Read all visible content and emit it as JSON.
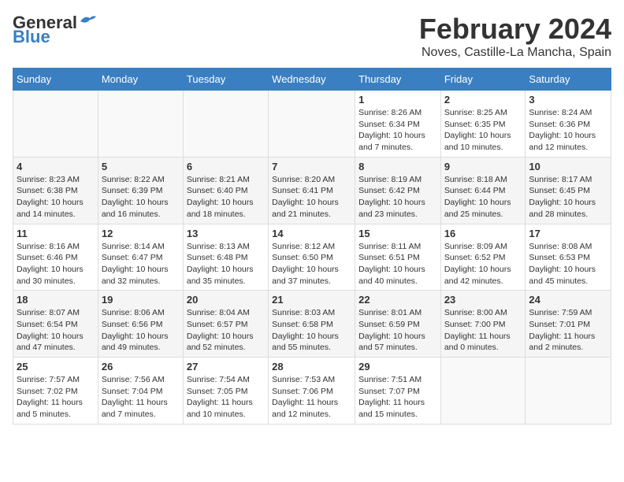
{
  "logo": {
    "general": "General",
    "blue": "Blue"
  },
  "title": "February 2024",
  "location": "Noves, Castille-La Mancha, Spain",
  "days_of_week": [
    "Sunday",
    "Monday",
    "Tuesday",
    "Wednesday",
    "Thursday",
    "Friday",
    "Saturday"
  ],
  "weeks": [
    [
      {
        "day": "",
        "info": ""
      },
      {
        "day": "",
        "info": ""
      },
      {
        "day": "",
        "info": ""
      },
      {
        "day": "",
        "info": ""
      },
      {
        "day": "1",
        "info": "Sunrise: 8:26 AM\nSunset: 6:34 PM\nDaylight: 10 hours\nand 7 minutes."
      },
      {
        "day": "2",
        "info": "Sunrise: 8:25 AM\nSunset: 6:35 PM\nDaylight: 10 hours\nand 10 minutes."
      },
      {
        "day": "3",
        "info": "Sunrise: 8:24 AM\nSunset: 6:36 PM\nDaylight: 10 hours\nand 12 minutes."
      }
    ],
    [
      {
        "day": "4",
        "info": "Sunrise: 8:23 AM\nSunset: 6:38 PM\nDaylight: 10 hours\nand 14 minutes."
      },
      {
        "day": "5",
        "info": "Sunrise: 8:22 AM\nSunset: 6:39 PM\nDaylight: 10 hours\nand 16 minutes."
      },
      {
        "day": "6",
        "info": "Sunrise: 8:21 AM\nSunset: 6:40 PM\nDaylight: 10 hours\nand 18 minutes."
      },
      {
        "day": "7",
        "info": "Sunrise: 8:20 AM\nSunset: 6:41 PM\nDaylight: 10 hours\nand 21 minutes."
      },
      {
        "day": "8",
        "info": "Sunrise: 8:19 AM\nSunset: 6:42 PM\nDaylight: 10 hours\nand 23 minutes."
      },
      {
        "day": "9",
        "info": "Sunrise: 8:18 AM\nSunset: 6:44 PM\nDaylight: 10 hours\nand 25 minutes."
      },
      {
        "day": "10",
        "info": "Sunrise: 8:17 AM\nSunset: 6:45 PM\nDaylight: 10 hours\nand 28 minutes."
      }
    ],
    [
      {
        "day": "11",
        "info": "Sunrise: 8:16 AM\nSunset: 6:46 PM\nDaylight: 10 hours\nand 30 minutes."
      },
      {
        "day": "12",
        "info": "Sunrise: 8:14 AM\nSunset: 6:47 PM\nDaylight: 10 hours\nand 32 minutes."
      },
      {
        "day": "13",
        "info": "Sunrise: 8:13 AM\nSunset: 6:48 PM\nDaylight: 10 hours\nand 35 minutes."
      },
      {
        "day": "14",
        "info": "Sunrise: 8:12 AM\nSunset: 6:50 PM\nDaylight: 10 hours\nand 37 minutes."
      },
      {
        "day": "15",
        "info": "Sunrise: 8:11 AM\nSunset: 6:51 PM\nDaylight: 10 hours\nand 40 minutes."
      },
      {
        "day": "16",
        "info": "Sunrise: 8:09 AM\nSunset: 6:52 PM\nDaylight: 10 hours\nand 42 minutes."
      },
      {
        "day": "17",
        "info": "Sunrise: 8:08 AM\nSunset: 6:53 PM\nDaylight: 10 hours\nand 45 minutes."
      }
    ],
    [
      {
        "day": "18",
        "info": "Sunrise: 8:07 AM\nSunset: 6:54 PM\nDaylight: 10 hours\nand 47 minutes."
      },
      {
        "day": "19",
        "info": "Sunrise: 8:06 AM\nSunset: 6:56 PM\nDaylight: 10 hours\nand 49 minutes."
      },
      {
        "day": "20",
        "info": "Sunrise: 8:04 AM\nSunset: 6:57 PM\nDaylight: 10 hours\nand 52 minutes."
      },
      {
        "day": "21",
        "info": "Sunrise: 8:03 AM\nSunset: 6:58 PM\nDaylight: 10 hours\nand 55 minutes."
      },
      {
        "day": "22",
        "info": "Sunrise: 8:01 AM\nSunset: 6:59 PM\nDaylight: 10 hours\nand 57 minutes."
      },
      {
        "day": "23",
        "info": "Sunrise: 8:00 AM\nSunset: 7:00 PM\nDaylight: 11 hours\nand 0 minutes."
      },
      {
        "day": "24",
        "info": "Sunrise: 7:59 AM\nSunset: 7:01 PM\nDaylight: 11 hours\nand 2 minutes."
      }
    ],
    [
      {
        "day": "25",
        "info": "Sunrise: 7:57 AM\nSunset: 7:02 PM\nDaylight: 11 hours\nand 5 minutes."
      },
      {
        "day": "26",
        "info": "Sunrise: 7:56 AM\nSunset: 7:04 PM\nDaylight: 11 hours\nand 7 minutes."
      },
      {
        "day": "27",
        "info": "Sunrise: 7:54 AM\nSunset: 7:05 PM\nDaylight: 11 hours\nand 10 minutes."
      },
      {
        "day": "28",
        "info": "Sunrise: 7:53 AM\nSunset: 7:06 PM\nDaylight: 11 hours\nand 12 minutes."
      },
      {
        "day": "29",
        "info": "Sunrise: 7:51 AM\nSunset: 7:07 PM\nDaylight: 11 hours\nand 15 minutes."
      },
      {
        "day": "",
        "info": ""
      },
      {
        "day": "",
        "info": ""
      }
    ]
  ]
}
